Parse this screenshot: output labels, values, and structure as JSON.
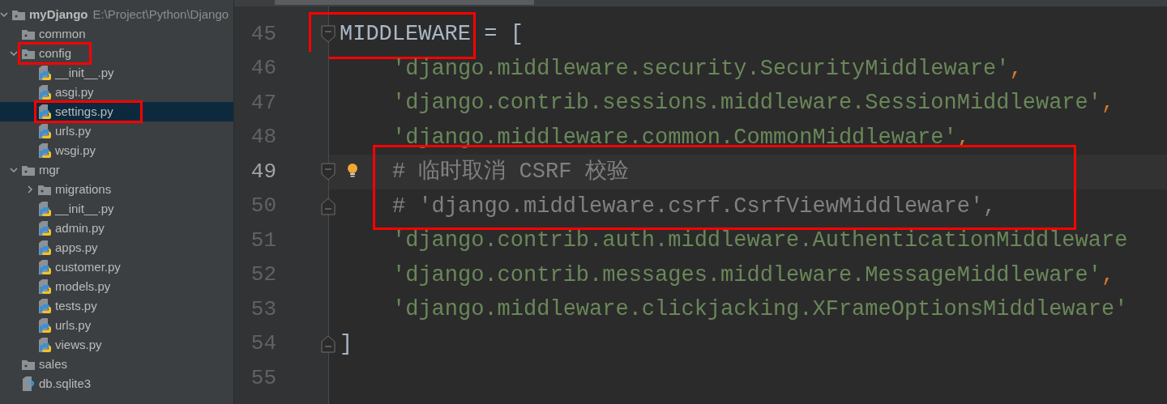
{
  "project_tree": {
    "items": [
      {
        "label": "myDjango",
        "path": "E:\\Project\\Python\\Django",
        "kind": "root",
        "expanded": true,
        "selected": false,
        "children": [
          {
            "label": "common",
            "kind": "folder",
            "selected": false
          },
          {
            "label": "config",
            "kind": "folder",
            "expanded": true,
            "selected": false,
            "annotated": true,
            "children": [
              {
                "label": "__init__.py",
                "kind": "python",
                "selected": false
              },
              {
                "label": "asgi.py",
                "kind": "python",
                "selected": false
              },
              {
                "label": "settings.py",
                "kind": "python",
                "selected": true,
                "annotated": true
              },
              {
                "label": "urls.py",
                "kind": "python",
                "selected": false
              },
              {
                "label": "wsgi.py",
                "kind": "python",
                "selected": false
              }
            ]
          },
          {
            "label": "mgr",
            "kind": "folder",
            "expanded": true,
            "selected": false,
            "children": [
              {
                "label": "migrations",
                "kind": "folder",
                "expanded": false,
                "selected": false
              },
              {
                "label": "__init__.py",
                "kind": "python",
                "selected": false
              },
              {
                "label": "admin.py",
                "kind": "python",
                "selected": false
              },
              {
                "label": "apps.py",
                "kind": "python",
                "selected": false
              },
              {
                "label": "customer.py",
                "kind": "python",
                "selected": false
              },
              {
                "label": "models.py",
                "kind": "python",
                "selected": false
              },
              {
                "label": "tests.py",
                "kind": "python",
                "selected": false
              },
              {
                "label": "urls.py",
                "kind": "python",
                "selected": false
              },
              {
                "label": "views.py",
                "kind": "python",
                "selected": false
              }
            ]
          },
          {
            "label": "sales",
            "kind": "folder",
            "selected": false
          },
          {
            "label": "db.sqlite3",
            "kind": "database",
            "selected": false
          }
        ]
      }
    ]
  },
  "editor": {
    "lines": [
      {
        "number": "45",
        "fold_start": true,
        "current": false,
        "tokens": [
          {
            "kind": "name",
            "text": "MIDDLEWARE",
            "annotated": true
          },
          {
            "kind": "plain",
            "text": " = ["
          }
        ]
      },
      {
        "number": "46",
        "current": false,
        "tokens": [
          {
            "kind": "string",
            "text": "'django.middleware.security.SecurityMiddleware'"
          },
          {
            "kind": "comma",
            "text": ","
          }
        ]
      },
      {
        "number": "47",
        "current": false,
        "tokens": [
          {
            "kind": "string",
            "text": "'django.contrib.sessions.middleware.SessionMiddleware'"
          },
          {
            "kind": "comma",
            "text": ","
          }
        ]
      },
      {
        "number": "48",
        "current": false,
        "tokens": [
          {
            "kind": "string",
            "text": "'django.middleware.common.CommonMiddleware'"
          },
          {
            "kind": "comma",
            "text": ","
          }
        ]
      },
      {
        "number": "49",
        "fold_start": true,
        "current": true,
        "bulb": true,
        "annotated": true,
        "tokens": [
          {
            "kind": "comment",
            "text": "# 临时取消 CSRF 校验"
          }
        ]
      },
      {
        "number": "50",
        "fold_end": true,
        "current": false,
        "annotated": true,
        "tokens": [
          {
            "kind": "comment",
            "text": "# 'django.middleware.csrf.CsrfViewMiddleware',"
          }
        ]
      },
      {
        "number": "51",
        "current": false,
        "tokens": [
          {
            "kind": "string",
            "text": "'django.contrib.auth.middleware.AuthenticationMiddleware"
          }
        ]
      },
      {
        "number": "52",
        "current": false,
        "tokens": [
          {
            "kind": "string",
            "text": "'django.contrib.messages.middleware.MessageMiddleware'"
          },
          {
            "kind": "comma",
            "text": ","
          }
        ]
      },
      {
        "number": "53",
        "current": false,
        "tokens": [
          {
            "kind": "string",
            "text": "'django.middleware.clickjacking.XFrameOptionsMiddleware'"
          }
        ]
      },
      {
        "number": "54",
        "fold_end": true,
        "current": false,
        "tokens": [
          {
            "kind": "plain",
            "text": "]"
          }
        ]
      },
      {
        "number": "55",
        "current": false
      }
    ]
  }
}
